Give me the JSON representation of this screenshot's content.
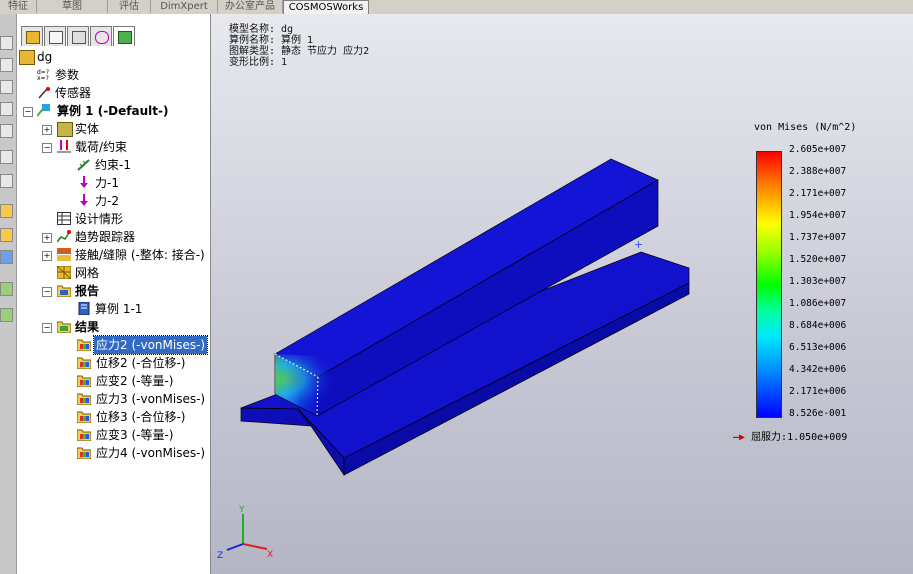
{
  "command_tabs": [
    "特征",
    "草图",
    "评估",
    "DimXpert",
    "办公室产品",
    "COSMOSWorks"
  ],
  "active_tab": "COSMOSWorks",
  "tree": {
    "root": "dg",
    "params": "参数",
    "sensors": "传感器",
    "study": "算例 1 (-Default-)",
    "solid": "实体",
    "loads": "载荷/约束",
    "fixture": "约束-1",
    "force1": "力-1",
    "force2": "力-2",
    "design_scenario": "设计情形",
    "trend_tracker": "趋势跟踪器",
    "contact": "接触/缝隙 (-整体: 接合-)",
    "mesh": "网格",
    "report": "报告",
    "report_item": "算例 1-1",
    "results": "结果",
    "result_items": [
      "应力2 (-vonMises-)",
      "位移2 (-合位移-)",
      "应变2 (-等量-)",
      "应力3 (-vonMises-)",
      "位移3 (-合位移-)",
      "应变3 (-等量-)",
      "应力4 (-vonMises-)"
    ]
  },
  "plot_info": {
    "line1": "模型名称: dg",
    "line2": "算例名称: 算例 1",
    "line3": "图解类型: 静态 节应力 应力2",
    "line4": "变形比例: 1"
  },
  "legend": {
    "title": "von Mises (N/m^2)",
    "values": [
      "2.605e+007",
      "2.388e+007",
      "2.171e+007",
      "1.954e+007",
      "1.737e+007",
      "1.520e+007",
      "1.303e+007",
      "1.086e+007",
      "8.684e+006",
      "6.513e+006",
      "4.342e+006",
      "2.171e+006",
      "8.526e-001"
    ],
    "yield_label": "屈服力:1.050e+009"
  },
  "colors": {
    "selection": "#316ac5",
    "model_blue": "#1010d8",
    "yield_arrow": "#e00000"
  }
}
